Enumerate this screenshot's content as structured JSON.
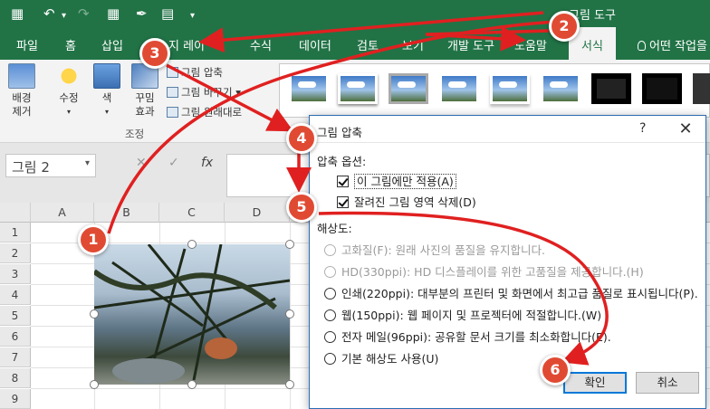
{
  "window": {
    "title": "그림 도구"
  },
  "quick_access": {
    "save_icon": "save-icon",
    "undo_icon": "undo-icon",
    "redo_icon": "redo-icon"
  },
  "tabs": [
    {
      "label": "파일"
    },
    {
      "label": "홈"
    },
    {
      "label": "삽입"
    },
    {
      "label": "지 레이"
    },
    {
      "label": "수식"
    },
    {
      "label": "데이터"
    },
    {
      "label": "검토"
    },
    {
      "label": "보기"
    },
    {
      "label": "개발 도구"
    },
    {
      "label": "도움말"
    },
    {
      "label": "서식"
    }
  ],
  "search_label": "어떤 작업을",
  "ribbon": {
    "remove_bg": "배경\n제거",
    "corrections": "수정",
    "color": "색",
    "artistic": "꾸밈\n효과",
    "compress": "그림 압축",
    "change": "그림 바꾸기",
    "reset": "그림 원래대로",
    "adjust_group": "조정"
  },
  "formula_bar": {
    "name_box": "그림 2",
    "fx": "fx"
  },
  "grid": {
    "columns": [
      "A",
      "B",
      "C",
      "D"
    ],
    "rows": [
      "1",
      "2",
      "3",
      "4",
      "5",
      "6",
      "7",
      "8",
      "9"
    ]
  },
  "dialog": {
    "title": "그림 압축",
    "help": "?",
    "close": "✕",
    "options_label": "압축 옵션:",
    "option_apply_only": "이 그림에만 적용(A)",
    "option_delete_cropped": "잘려진 그림 영역 삭제(D)",
    "resolution_label": "해상도:",
    "resolutions": [
      {
        "label": "고화질(F): 원래 사진의 품질을 유지합니다.",
        "disabled": true
      },
      {
        "label": "HD(330ppi): HD 디스플레이를 위한 고품질을 제공합니다.(H)",
        "disabled": true
      },
      {
        "label": "인쇄(220ppi): 대부분의 프린터 및 화면에서 최고급 품질로 표시됩니다(P).",
        "disabled": false
      },
      {
        "label": "웹(150ppi): 웹 페이지 및 프로젝터에 적절합니다.(W)",
        "disabled": false
      },
      {
        "label": "전자 메일(96ppi): 공유할 문서 크기를 최소화합니다(E).",
        "disabled": false
      },
      {
        "label": "기본 해상도 사용(U)",
        "disabled": false
      }
    ],
    "ok": "확인",
    "cancel": "취소"
  },
  "annotations": [
    "1",
    "2",
    "3",
    "4",
    "5",
    "6"
  ],
  "colors": {
    "excel_green": "#217346",
    "annotation_red": "#e04a33",
    "dialog_border": "#2b6cb3"
  }
}
